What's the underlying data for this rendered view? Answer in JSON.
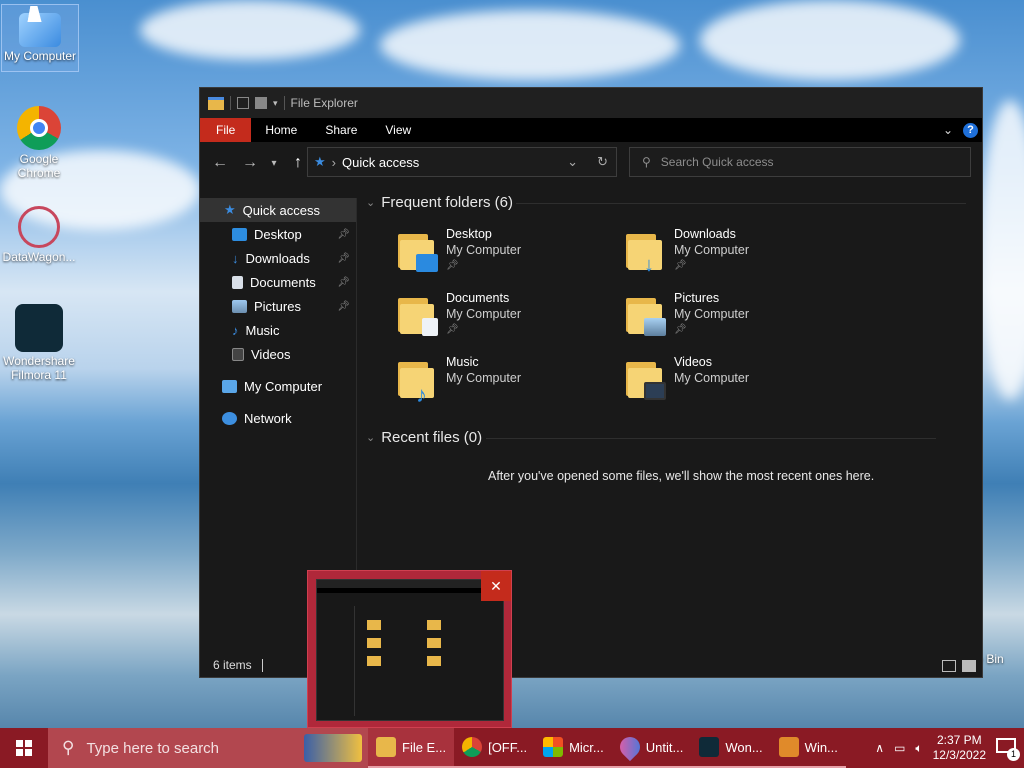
{
  "desktop": {
    "icons": [
      {
        "label": "My Computer",
        "icon": "computer-icon"
      },
      {
        "label": "Google Chrome",
        "icon": "chrome-icon"
      },
      {
        "label": "DataWagon...",
        "icon": "datawagon-icon"
      },
      {
        "label": "Wondershare Filmora 11",
        "icon": "filmora-icon"
      }
    ],
    "recycle_bin_partial": "e Bin"
  },
  "explorer": {
    "title": "File Explorer",
    "ribbon_tabs": [
      "File",
      "Home",
      "Share",
      "View"
    ],
    "address": "Quick access",
    "search_placeholder": "Search Quick access",
    "nav": [
      {
        "label": "Quick access",
        "icon": "star-icon",
        "selected": true
      },
      {
        "label": "Desktop",
        "icon": "desktop-icon",
        "pinned": true
      },
      {
        "label": "Downloads",
        "icon": "download-arrow-icon",
        "pinned": true
      },
      {
        "label": "Documents",
        "icon": "document-icon",
        "pinned": true
      },
      {
        "label": "Pictures",
        "icon": "picture-icon",
        "pinned": true
      },
      {
        "label": "Music",
        "icon": "music-note-icon"
      },
      {
        "label": "Videos",
        "icon": "video-icon"
      },
      {
        "label": "My Computer",
        "icon": "computer-icon"
      },
      {
        "label": "Network",
        "icon": "network-icon"
      }
    ],
    "frequent_header": "Frequent folders (6)",
    "folders": [
      {
        "name": "Desktop",
        "location": "My Computer",
        "pinned": true
      },
      {
        "name": "Downloads",
        "location": "My Computer",
        "pinned": true
      },
      {
        "name": "Documents",
        "location": "My Computer",
        "pinned": true
      },
      {
        "name": "Pictures",
        "location": "My Computer",
        "pinned": true
      },
      {
        "name": "Music",
        "location": "My Computer"
      },
      {
        "name": "Videos",
        "location": "My Computer"
      }
    ],
    "recent_header": "Recent files (0)",
    "recent_empty": "After you've opened some files, we'll show the most recent ones here.",
    "status": "6 items"
  },
  "taskbar": {
    "search_placeholder": "Type here to search",
    "apps": [
      {
        "label": "File E...",
        "icon": "folder-icon",
        "active": true
      },
      {
        "label": "[OFF...",
        "icon": "chrome-icon"
      },
      {
        "label": "Micr...",
        "icon": "store-icon"
      },
      {
        "label": "Untit...",
        "icon": "paint-drop-icon"
      },
      {
        "label": "Won...",
        "icon": "filmora-icon"
      },
      {
        "label": "Win...",
        "icon": "media-player-icon"
      }
    ],
    "time": "2:37 PM",
    "date": "12/3/2022",
    "notifications": "1"
  },
  "colors": {
    "taskbar": "#8a1a24",
    "accent": "#c42b1c",
    "window_bg": "#191919"
  }
}
